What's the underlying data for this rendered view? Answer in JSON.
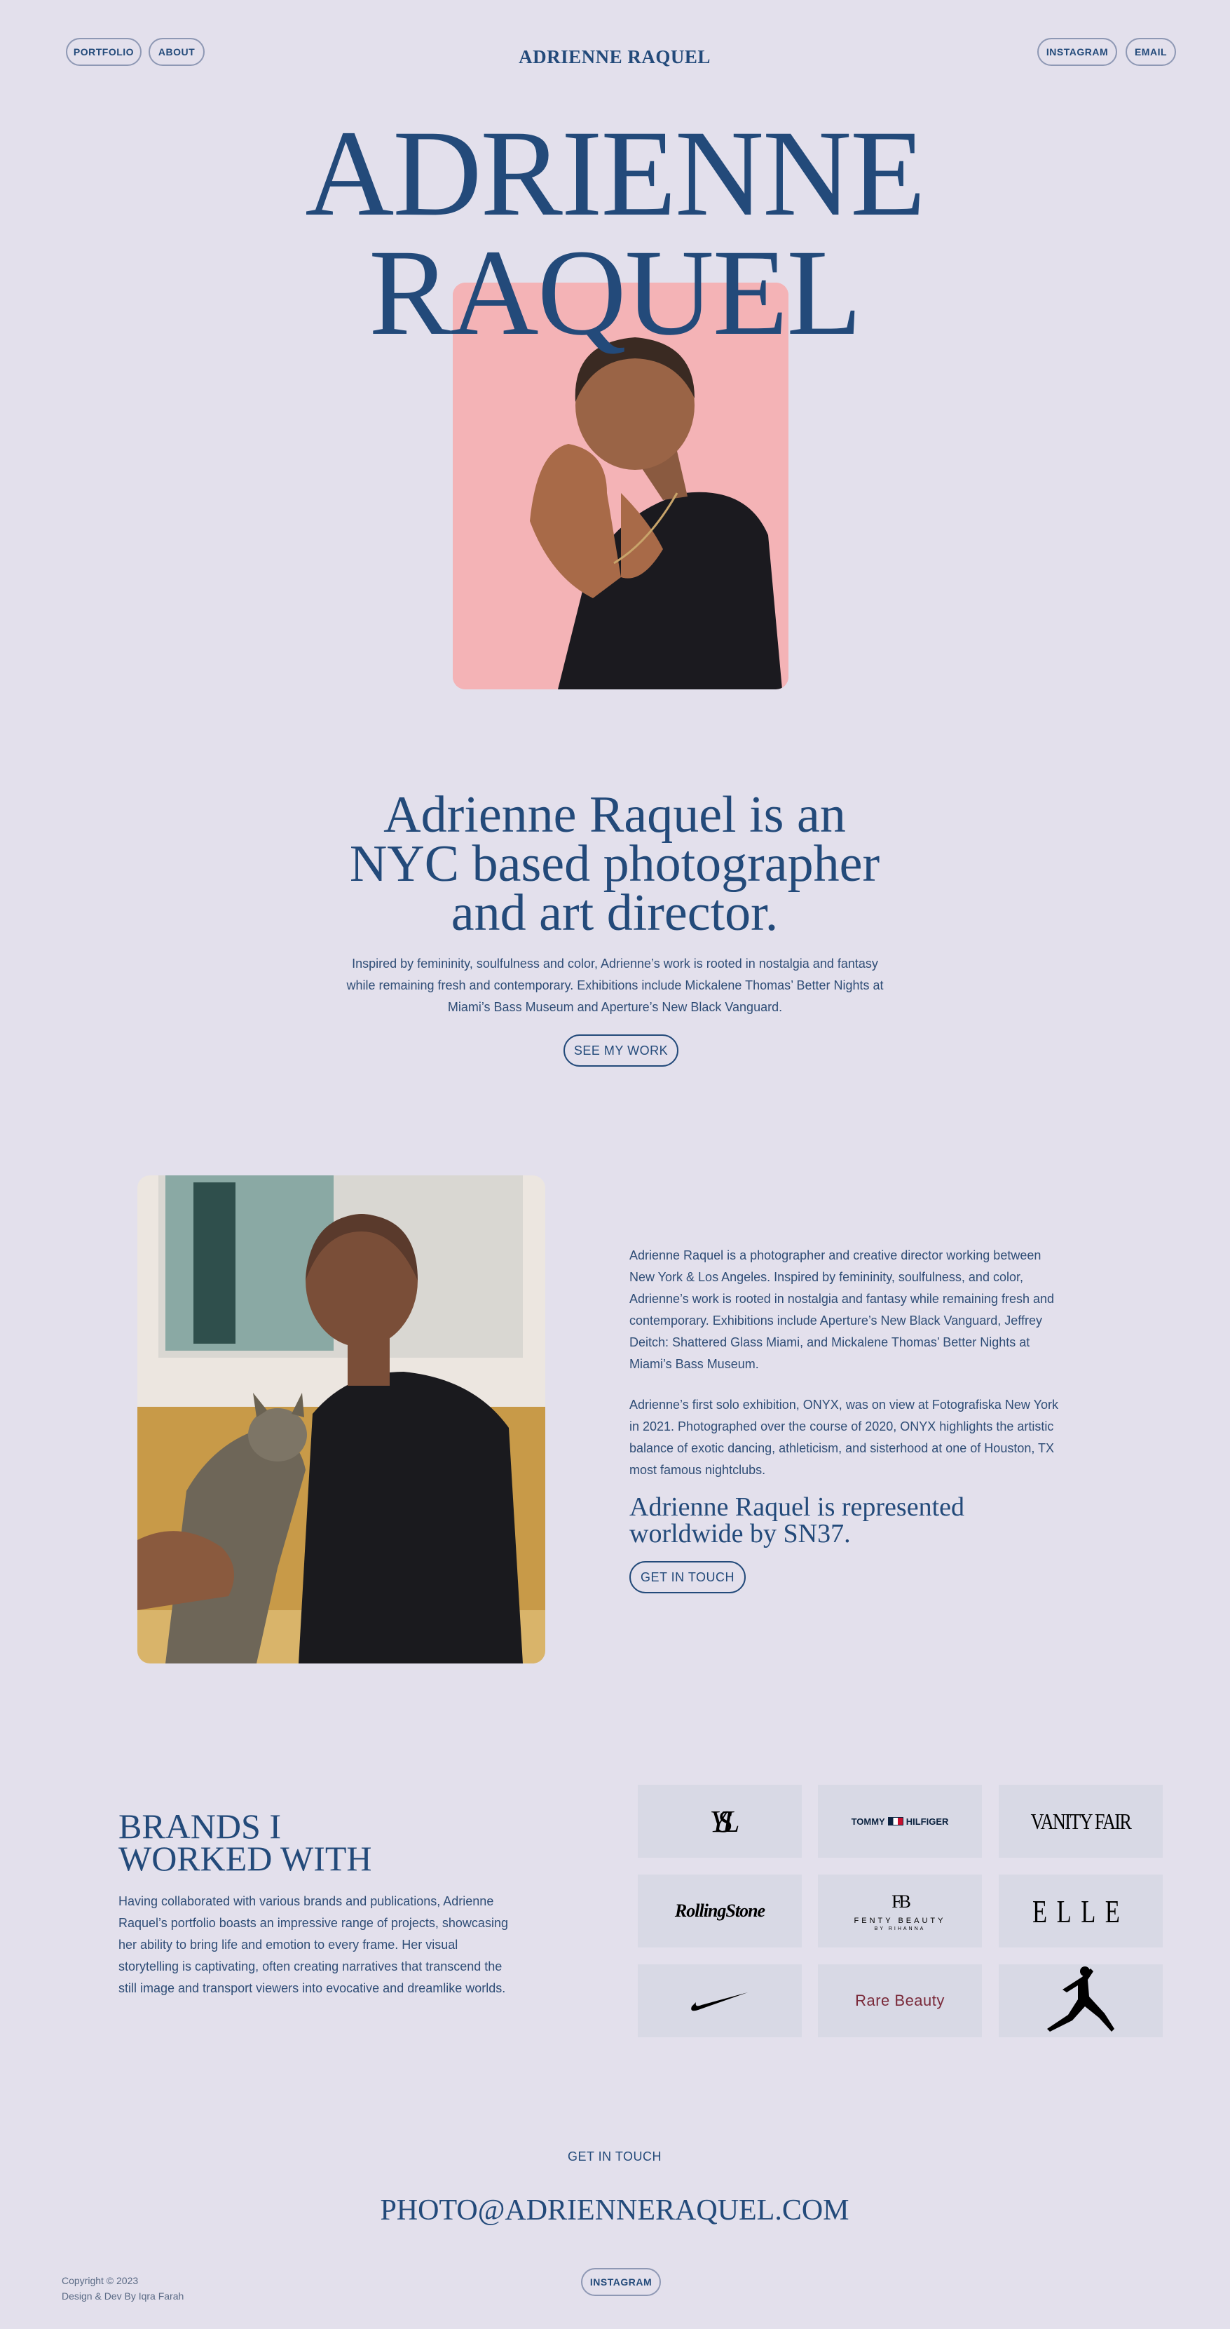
{
  "nav": {
    "left": [
      "PORTFOLIO",
      "ABOUT"
    ],
    "brand": "ADRIENNE RAQUEL",
    "right": [
      "INSTAGRAM",
      "EMAIL"
    ]
  },
  "hero": {
    "title_line1": "ADRIENNE",
    "title_line2": "RAQUEL",
    "photo_bg": "#f4b3b6"
  },
  "intro": {
    "heading_line1": "Adrienne Raquel is an",
    "heading_line2": "NYC based photographer",
    "heading_line3": "and art director.",
    "text": "Inspired by femininity, soulfulness and color, Adrienne’s work is rooted in nostalgia and fantasy while remaining fresh and contemporary. Exhibitions include Mickalene Thomas’ Better Nights at Miami’s Bass Museum and Aperture’s New Black Vanguard.",
    "button": "SEE MY WORK"
  },
  "about": {
    "para1": "Adrienne Raquel is a photographer and creative director working between New York & Los Angeles. Inspired by femininity, soulfulness, and color, Adrienne’s work is rooted in nostalgia and fantasy while remaining fresh and contemporary. Exhibitions include Aperture’s New Black Vanguard, Jeffrey Deitch: Shattered Glass Miami, and Mickalene Thomas’ Better Nights at Miami’s Bass Museum.",
    "para2": "Adrienne’s first solo exhibition, ONYX, was on view at Fotografiska New York in 2021. Photographed over the course of 2020, ONYX highlights the artistic balance of exotic dancing, athleticism, and sisterhood at one of Houston, TX most famous nightclubs.",
    "represented_line1": "Adrienne Raquel is represented",
    "represented_line2": "worldwide by SN37.",
    "button": "GET IN TOUCH"
  },
  "brands": {
    "heading_line1": "BRANDS I",
    "heading_line2": "WORKED WITH",
    "text": "Having collaborated with various brands and publications, Adrienne Raquel’s portfolio boasts an impressive range of projects, showcasing her ability to bring life and emotion to every frame. Her visual storytelling is captivating, often creating narratives that transcend the still image and transport viewers into evocative and dreamlike worlds.",
    "logos": {
      "ysl": "YSL",
      "tommy_a": "TOMMY",
      "tommy_b": "HILFIGER",
      "vanity": "VANITY FAIR",
      "rolling": "RollingStone",
      "fenty_mark": "FB",
      "fenty_name": "FENTY BEAUTY",
      "fenty_sub": "BY RIHANNA",
      "elle": "ELLE",
      "nike": "nike-swoosh",
      "rare": "Rare Beauty",
      "jordan": "jumpman"
    }
  },
  "contact": {
    "label": "GET IN TOUCH",
    "email": "PHOTO@ADRIENNERAQUEL.COM"
  },
  "footer": {
    "copyright": "Copyright © 2023",
    "credit": "Design & Dev By Iqra Farah",
    "instagram": "INSTAGRAM"
  },
  "colors": {
    "background": "#e3e0ec",
    "navy": "#234a7a",
    "tile": "#d8d9e5",
    "rare_beauty": "#7a2a3a"
  }
}
